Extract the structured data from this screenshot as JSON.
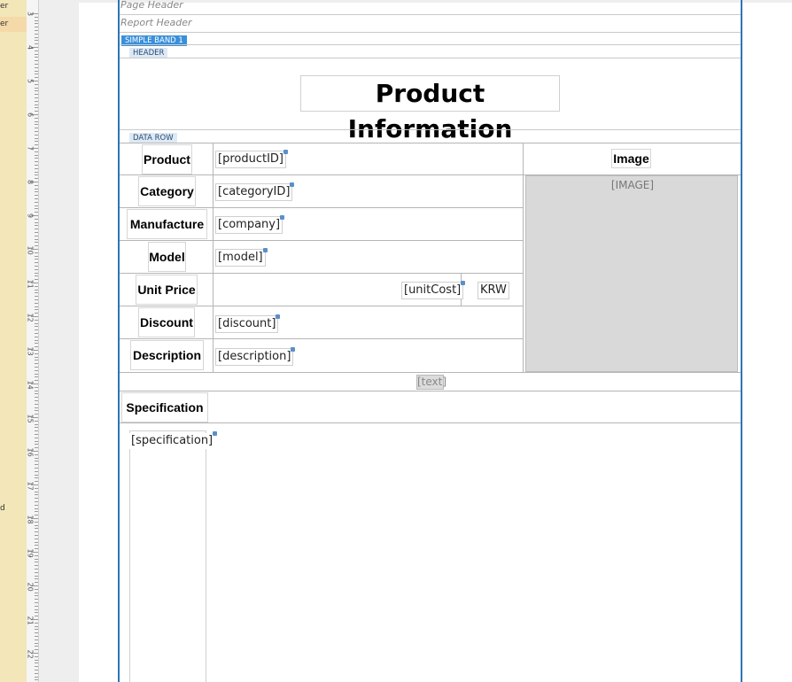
{
  "outline": {
    "items": [
      "er",
      "er",
      "d"
    ]
  },
  "ruler": {
    "numbers": [
      "3",
      "4",
      "5",
      "6",
      "7",
      "8",
      "9",
      "10",
      "11",
      "12",
      "13",
      "14",
      "15",
      "16",
      "17",
      "18",
      "19",
      "20",
      "21",
      "22",
      "3"
    ]
  },
  "bands": {
    "page_header": "Page Header",
    "report_header": "Report Header",
    "simple_band": "SIMPLE BAND 1",
    "header_tag": "HEADER",
    "data_row_tag": "DATA ROW"
  },
  "report": {
    "title": "Product Information",
    "rows": [
      {
        "label": "Product",
        "field": "[productID]"
      },
      {
        "label": "Category",
        "field": "[categoryID]"
      },
      {
        "label": "Manufacture",
        "field": "[company]"
      },
      {
        "label": "Model",
        "field": "[model]"
      },
      {
        "label": "Unit Price",
        "field": "[unitCost]",
        "suffix": "KRW"
      },
      {
        "label": "Discount",
        "field": "[discount]"
      },
      {
        "label": "Description",
        "field": "[description]"
      }
    ],
    "image_label": "Image",
    "image_placeholder": "[IMAGE]",
    "text_field": "[text]",
    "spec_label": "Specification",
    "spec_field": "[specification]"
  },
  "colors": {
    "accent": "#2e75b6",
    "tag_blue": "#3b8fd9",
    "outline_bg": "#f3e6b8"
  }
}
